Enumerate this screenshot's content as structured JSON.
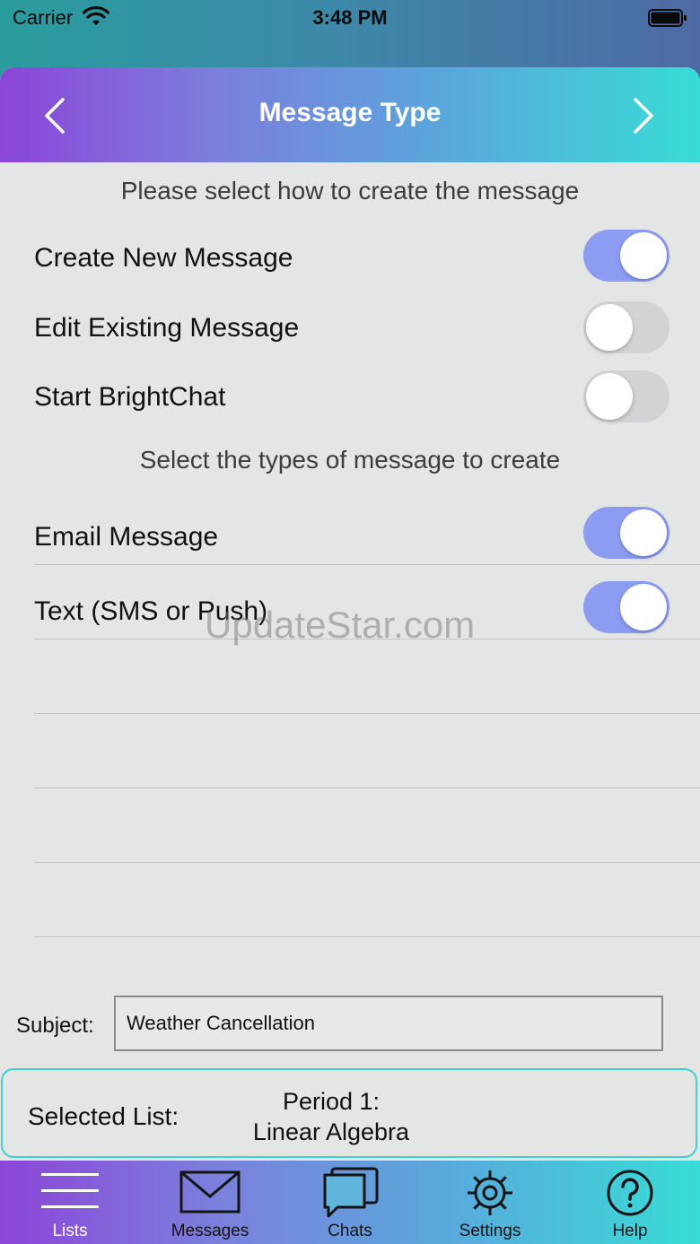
{
  "status_bar": {
    "carrier": "Carrier",
    "time": "3:48 PM",
    "icons": [
      "wifi-icon",
      "battery-icon"
    ]
  },
  "nav": {
    "title": "Message Type",
    "back_icon": "chevron-left-icon",
    "forward_icon": "chevron-right-icon"
  },
  "create_section": {
    "label": "Please select how to create the message",
    "options": [
      {
        "label": "Create New Message",
        "on": true
      },
      {
        "label": "Edit Existing Message",
        "on": false
      },
      {
        "label": "Start BrightChat",
        "on": false
      }
    ]
  },
  "types_section": {
    "label": "Select the types of message to create",
    "options": [
      {
        "label": "Email Message",
        "on": true
      },
      {
        "label": "Text (SMS or Push)",
        "on": true
      }
    ]
  },
  "watermark": "UpdateStar.com",
  "subject": {
    "label": "Subject:",
    "value": "Weather Cancellation"
  },
  "selected_list": {
    "label": "Selected List:",
    "value_line1": "Period 1:",
    "value_line2": "Linear Algebra"
  },
  "tabs": [
    {
      "label": "Lists",
      "icon": "hamburger-menu-icon",
      "active": true
    },
    {
      "label": "Messages",
      "icon": "envelope-icon",
      "active": false
    },
    {
      "label": "Chats",
      "icon": "chat-bubbles-icon",
      "active": false
    },
    {
      "label": "Settings",
      "icon": "gear-icon",
      "active": false
    },
    {
      "label": "Help",
      "icon": "question-circle-icon",
      "active": false
    }
  ],
  "colors": {
    "toggle_on": "#8c9cf3",
    "toggle_off": "#d2d3d4",
    "gradient_start": "#8c45d8",
    "gradient_end": "#38dcd6",
    "panel_border": "#3fd0d0"
  }
}
